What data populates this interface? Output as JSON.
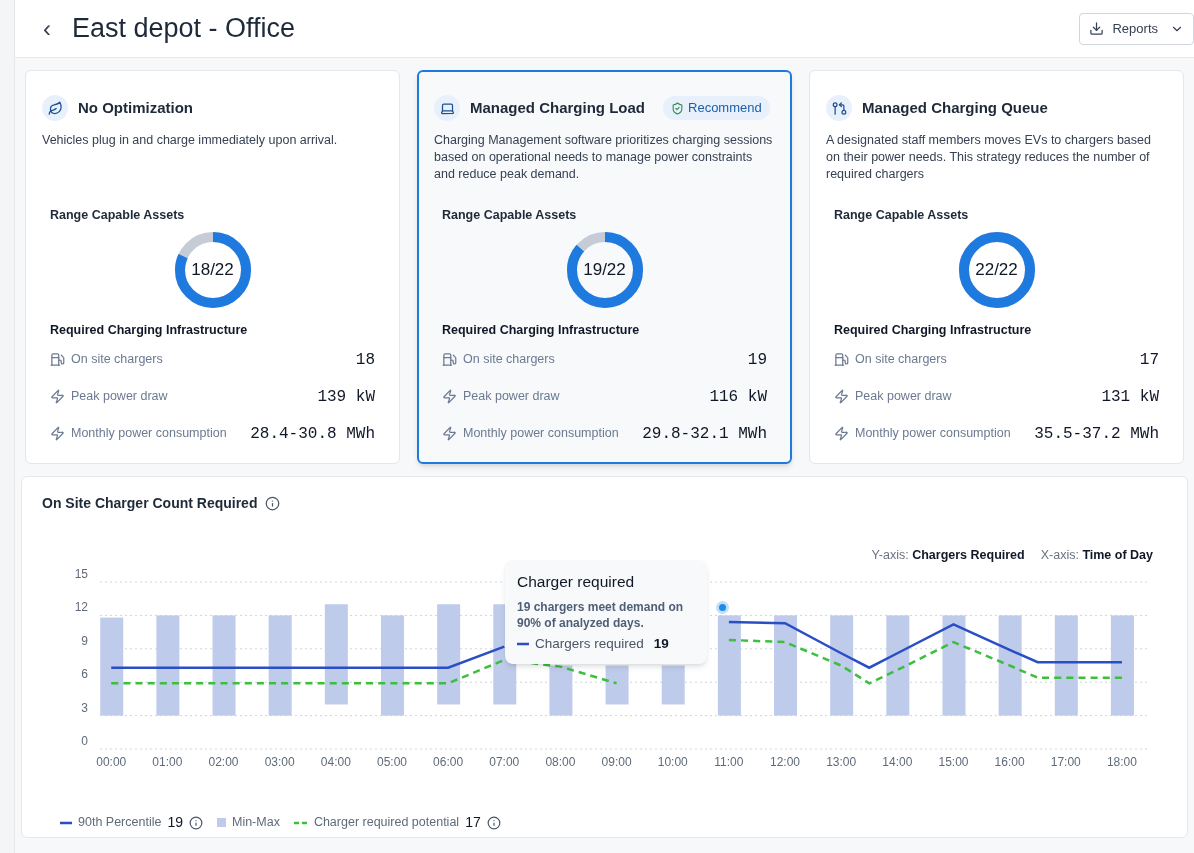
{
  "header": {
    "back": "‹",
    "title": "East depot - Office",
    "reports_button": "Reports"
  },
  "cards": [
    {
      "title": "No Optimization",
      "selected": false,
      "description": "Vehicles plug in and charge immediately upon arrival.",
      "assets_label": "Range Capable Assets",
      "assets": "18/22",
      "level": 0.818,
      "infra_label": "Required Charging Infrastructure",
      "metrics": [
        {
          "kind": "charger",
          "label": "On site chargers",
          "value": "18"
        },
        {
          "kind": "bolt",
          "label": "Peak power draw",
          "value": "139 kW"
        },
        {
          "kind": "bolt",
          "label": "Monthly power consumption",
          "value": "28.4-30.8 MWh"
        }
      ]
    },
    {
      "title": "Managed Charging Load",
      "badge": "Recommend",
      "selected": true,
      "description": "Charging Management software prioritizes charging sessions based on operational needs to manage power constraints and reduce peak demand.",
      "assets_label": "Range Capable Assets",
      "assets": "19/22",
      "level": 0.864,
      "infra_label": "Required Charging Infrastructure",
      "metrics": [
        {
          "kind": "charger",
          "label": "On site chargers",
          "value": "19"
        },
        {
          "kind": "bolt",
          "label": "Peak power draw",
          "value": "116 kW"
        },
        {
          "kind": "bolt",
          "label": "Monthly power consumption",
          "value": "29.8-32.1 MWh"
        }
      ]
    },
    {
      "title": "Managed Charging Queue",
      "selected": false,
      "description": "A designated staff members moves EVs to chargers based on their power needs. This strategy reduces the number of required chargers",
      "assets_label": "Range Capable Assets",
      "assets": "22/22",
      "level": 1,
      "infra_label": "Required Charging Infrastructure",
      "metrics": [
        {
          "kind": "charger",
          "label": "On site chargers",
          "value": "17"
        },
        {
          "kind": "bolt",
          "label": "Peak power draw",
          "value": "131 kW"
        },
        {
          "kind": "bolt",
          "label": "Monthly power consumption",
          "value": "35.5-37.2 MWh"
        }
      ]
    }
  ],
  "chart_panel": {
    "title": "On Site Charger Count Required",
    "axis_legend": [
      {
        "prefix": "Y-axis:",
        "value": "Chargers Required"
      },
      {
        "prefix": "X-axis:",
        "value": "Time of Day"
      }
    ],
    "chart_data": {
      "type": "line",
      "x": [
        0,
        1,
        2,
        3,
        4,
        5,
        6,
        7,
        8,
        9,
        10,
        11,
        12,
        13,
        13.5,
        14,
        15,
        16,
        16.5,
        17,
        18
      ],
      "xticks": [
        {
          "value": 0,
          "label": "00:00"
        },
        {
          "value": 1,
          "label": "01:00"
        },
        {
          "value": 2,
          "label": "02:00"
        },
        {
          "value": 3,
          "label": "03:00"
        },
        {
          "value": 4,
          "label": "04:00"
        },
        {
          "value": 5,
          "label": "05:00"
        },
        {
          "value": 6,
          "label": "06:00"
        },
        {
          "value": 7,
          "label": "07:00"
        },
        {
          "value": 8,
          "label": "08:00"
        },
        {
          "value": 9,
          "label": "09:00"
        },
        {
          "value": 10,
          "label": "10:00"
        },
        {
          "value": 11,
          "label": "11:00"
        },
        {
          "value": 12,
          "label": "12:00"
        },
        {
          "value": 13,
          "label": "13:00"
        },
        {
          "value": 14,
          "label": "14:00"
        },
        {
          "value": 15,
          "label": "15:00"
        },
        {
          "value": 16,
          "label": "16:00"
        },
        {
          "value": 17,
          "label": "17:00"
        },
        {
          "value": 18,
          "label": "18:00"
        }
      ],
      "xlim": [
        -0.2,
        18.5
      ],
      "ylim": [
        0,
        15
      ],
      "yticks": [
        0,
        3,
        6,
        9,
        12,
        15
      ],
      "grid": true,
      "series": [
        {
          "name": "90th Percentile",
          "color": "#2a4fc4",
          "values": [
            7.3,
            7.3,
            7.3,
            7.3,
            7.3,
            7.3,
            7.3,
            9.2,
            null,
            null,
            null,
            11.4,
            11.3,
            8.6,
            7.3,
            8.6,
            11.2,
            8.9,
            7.8,
            7.8,
            7.8
          ]
        },
        {
          "name": "Charger required potential",
          "color": "#3cbf3c",
          "line_style": "dashed",
          "values": [
            5.9,
            5.9,
            5.9,
            5.9,
            5.9,
            5.9,
            5.9,
            8,
            7.4,
            5.9,
            null,
            9.8,
            9.6,
            7.5,
            5.9,
            7.1,
            9.6,
            7.5,
            6.4,
            6.4,
            6.4
          ]
        },
        {
          "name": "Min-Max",
          "color": "#bfcbeb",
          "type": "candlestick",
          "ohlc": [
            [
              3,
              11.8,
              3,
              11.8
            ],
            [
              3,
              12,
              3,
              12
            ],
            [
              3,
              12,
              3,
              12
            ],
            [
              3,
              12,
              3,
              12
            ],
            [
              4,
              13,
              4,
              13
            ],
            [
              3,
              12,
              3,
              12
            ],
            [
              4,
              13,
              4,
              13
            ],
            [
              4,
              13,
              4,
              13
            ],
            [
              3,
              7.5,
              3,
              7.5
            ],
            [
              4,
              7.5,
              4,
              7.5
            ],
            [
              4,
              7.5,
              4,
              7.5
            ],
            [
              3,
              12,
              3,
              12
            ],
            [
              3,
              12,
              3,
              12
            ],
            [
              3,
              12,
              3,
              12
            ],
            null,
            [
              3,
              12,
              3,
              12
            ],
            [
              3,
              12,
              3,
              12
            ],
            [
              3,
              12,
              3,
              12
            ],
            null,
            [
              3,
              12,
              3,
              12
            ],
            [
              3,
              12,
              3,
              12
            ]
          ]
        }
      ]
    },
    "tooltip": {
      "title": "Charger required",
      "text": "19 chargers meet demand on 90% of analyzed days.",
      "series_label": "Chargers required",
      "value": "19"
    },
    "legend_values": [
      "19",
      "17"
    ]
  }
}
